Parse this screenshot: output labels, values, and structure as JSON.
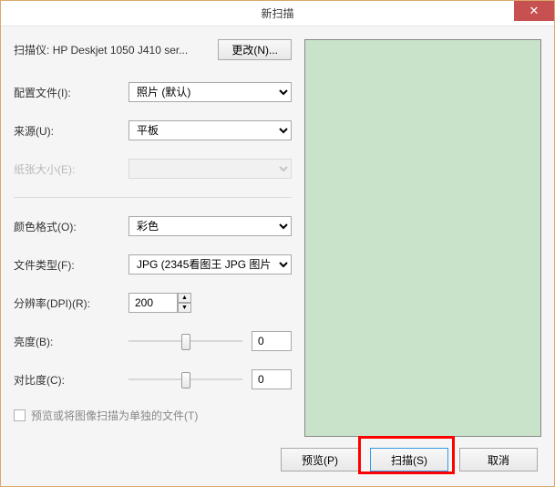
{
  "window": {
    "title": "新扫描"
  },
  "scanner": {
    "prefix": "扫描仪:",
    "name": "HP Deskjet 1050 J410 ser...",
    "change_btn": "更改(N)..."
  },
  "labels": {
    "profile": "配置文件(I):",
    "source": "来源(U):",
    "paper_size": "纸张大小(E):",
    "color_format": "颜色格式(O):",
    "file_type": "文件类型(F):",
    "dpi": "分辨率(DPI)(R):",
    "brightness": "亮度(B):",
    "contrast": "对比度(C):"
  },
  "values": {
    "profile": "照片 (默认)",
    "source": "平板",
    "paper_size": "",
    "color_format": "彩色",
    "file_type": "JPG (2345看图王 JPG 图片",
    "dpi": "200",
    "brightness": "0",
    "contrast": "0"
  },
  "checkbox": {
    "label": "预览或将图像扫描为单独的文件(T)"
  },
  "buttons": {
    "preview": "预览(P)",
    "scan": "扫描(S)",
    "cancel": "取消"
  }
}
